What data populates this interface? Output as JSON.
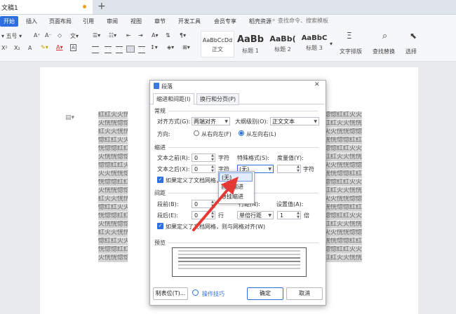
{
  "window": {
    "doc_tab": "文稿1",
    "new_tab": "+"
  },
  "ribbon": {
    "start": "开始",
    "tabs": [
      "插入",
      "页面布局",
      "引用",
      "审阅",
      "视图",
      "章节",
      "开发工具",
      "会员专享",
      "稻壳资源"
    ],
    "search_placeholder": "查找命令、搜索模板",
    "font_size": "五号",
    "row2_tools": [
      "X²",
      "X₂",
      "A"
    ],
    "styles": [
      {
        "sample": "AaBbCcDd",
        "name": "正文"
      },
      {
        "sample": "AaBb",
        "name": "标题 1"
      },
      {
        "sample": "AaBb(",
        "name": "标题 2"
      },
      {
        "sample": "AaBbC",
        "name": "标题 3"
      }
    ],
    "right_tools": [
      "文字排版",
      "查找替换",
      "选择"
    ]
  },
  "document": {
    "left_lines": [
      "红红火火恍恍惚惚红红火",
      "火恍恍惚惚红红火火恍恍",
      "红火火恍恍惚惚红红火火",
      "惚红红火火恍恍惚惚红红",
      "恍惚惚红红火火恍恍惚惚",
      "火恍恍惚惚红红火火恍恍",
      "惚惚红红火火恍恍惚惚红",
      "火火恍恍惚惚红红火火恍",
      "恍惚惚红红火火恍恍惚惚",
      "火恍恍惚惚红红火火恍恍",
      "红火火恍恍惚惚红红火火",
      "惚红红火火恍恍惚惚红红",
      "恍惚惚红红火火恍恍惚惚",
      "火恍恍惚惚红红火火恍恍",
      "红火火恍恍惚惚红红火火",
      "惚红红火火恍恍惚惚红红",
      "恍惚惚红红火火恍恍惚惚",
      "火恍恍惚惚红红火火恍恍"
    ],
    "right_lines": [
      "惚惚红红火火",
      "红红火火恍恍",
      "火火恍恍惚惚",
      "恍恍惚惚红红",
      "惚惚红红火火",
      "红红火火恍恍",
      "火火恍恍惚惚",
      "恍恍惚惚红红",
      "惚惚红红火火",
      "红红火火恍恍",
      "火火恍恍惚惚",
      "恍恍惚惚红红",
      "惚惚红红火火",
      "红红火火恍恍",
      "火火恍恍惚惚",
      "恍恍惚惚红红",
      "惚惚红红火火",
      "红红火火恍恍"
    ]
  },
  "dialog": {
    "title": "段落",
    "close": "✕",
    "tabs": [
      "缩进和间距(I)",
      "换行和分页(P)"
    ],
    "general": {
      "section": "常规",
      "align_label": "对齐方式(G):",
      "align_value": "两端对齐",
      "outline_label": "大纲级别(O):",
      "outline_value": "正文文本",
      "direction_label": "方向:",
      "rtl": "从右向左(F)",
      "ltr": "从左向右(L)"
    },
    "indent": {
      "section": "缩进",
      "before_label": "文本之前(R):",
      "before_value": "0",
      "after_label": "文本之后(X):",
      "after_value": "0",
      "unit": "字符",
      "special_label": "特殊格式(S):",
      "special_value": "(无)",
      "measure_label": "度量值(Y):",
      "grid_check": "如果定义了文档网格，则自动"
    },
    "spacing": {
      "section": "间距",
      "before_label": "段前(B):",
      "before_value": "0",
      "after_label": "段后(E):",
      "after_value": "0",
      "unit": "行",
      "line_label": "行距(N):",
      "line_value": "单倍行距",
      "set_label": "设置值(A):",
      "set_value": "1",
      "set_unit": "倍",
      "grid_check": "如果定义了文档网格，则与网格对齐(W)"
    },
    "preview": {
      "section": "预览"
    },
    "buttons": {
      "tabs": "制表位(T)...",
      "tips": "操作技巧",
      "ok": "确定",
      "cancel": "取消"
    },
    "dropdown": [
      "(无)",
      "首行缩进",
      "悬挂缩进"
    ]
  },
  "colors": {
    "accent": "#2d6fe0",
    "arrow": "#e53935"
  }
}
